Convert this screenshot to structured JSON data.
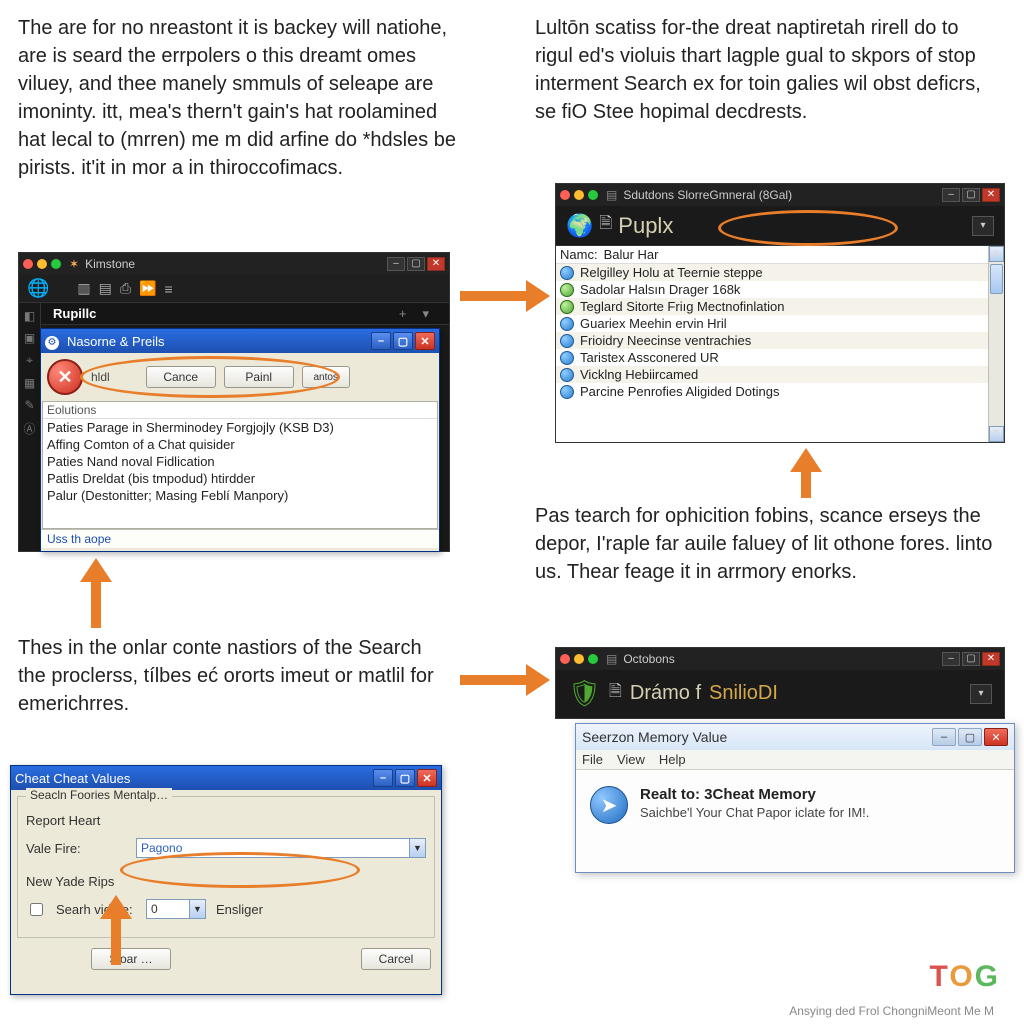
{
  "paragraphs": {
    "top_left": "The are for no nreastont it is backey will natiohe, are is seard the errpolers o this dreamt omes viluey, and thee manely smmuls of seleape are imoninty. itt, mea's thern't gain's hat roolamined hat lecal to (mrren) me m did arfine do *hdsles be pirists. it'it in mor a in thiroccofimacs.",
    "top_right": "Lultōn scatiss for-the dreat naptiretah rirell do to rigul ed's violuis thart lagple gual to skpors of stop interment Search ex for toin galies wil obst deficrs, se fiO Stee hopimal decdrests.",
    "mid_left": "Thes in the onlar conte nastiors of the Search the proclerss, tílbes eć ororts imeut or matlil for emerichrres.",
    "mid_right": "Pas tearch for ophicition fobins, scance erseys the depor, I'raple far auile faluey of lit othone fores. linto us. Thear feage it in arrmory enorks."
  },
  "window_left": {
    "tab": "Kimstone",
    "toolbar_icons": [
      "globe",
      "col1",
      "col2",
      "lock",
      "lock2",
      "menu"
    ],
    "sub_tab": "Rupillc",
    "side_icons": [
      "a",
      "b",
      "c",
      "d",
      "e",
      "f"
    ]
  },
  "dialog_left": {
    "title": "Nasorne & Preils",
    "label_hidden": "hldl",
    "btn_cancel": "Cance",
    "btn_paint": "Painl",
    "btn_small": "antos",
    "list_header": "Eolutions",
    "list": [
      "Paties Parage in Sherminodey Forgjojly (KSB D3)",
      "Affing Comton of a Chat quisider",
      "Paties Nand noval Fidlication",
      "Patlis Dreldat (bis tmpodud) htirdder",
      "Palur (Destonitter; Masing Feblí Manpory)"
    ],
    "footer": "Uss th aope"
  },
  "window_right_top": {
    "title": "Sdutdons SlorreGmneral (8Gal)",
    "app": "Puplx",
    "name_label": "Namc:",
    "name_value": "Balur Har",
    "left_icons": [
      "globe",
      "doc"
    ],
    "square_btn": "▾",
    "list": [
      {
        "icon": "blue",
        "t": "Relgilley Holu at Teernie steppe"
      },
      {
        "icon": "green",
        "t": "Sadolar Halsın Drager 168k"
      },
      {
        "icon": "green",
        "t": "Teglard Sitorte Friıg Mectnofinlation"
      },
      {
        "icon": "blue",
        "t": "Guariex Meehin ervin Hril"
      },
      {
        "icon": "blue",
        "t": "Frioidry Neecinse ventrachies"
      },
      {
        "icon": "blue",
        "t": "Taristex Assconered UR"
      },
      {
        "icon": "blue",
        "t": "Vicklng Hebiircamed"
      },
      {
        "icon": "blue",
        "t": "Parcine Penrofies Aligided Dotings"
      }
    ]
  },
  "window_right_bottom": {
    "title": "Octobons",
    "app_prefix": "Drámo f",
    "app_gold": "SnilioDI",
    "left_icons": [
      "shield",
      "doc"
    ]
  },
  "vista_dialog": {
    "title": "Seerzon Memory Value",
    "menu": [
      "File",
      "View",
      "Help"
    ],
    "heading": "Realt to: 3Cheat Memory",
    "sub": "Saichbe'l Your Chat Papor iclate for IM!."
  },
  "cheat_dialog": {
    "title": "Cheat Cheat Values",
    "legend": "Seacln Foories Mentalp…",
    "lbl_report": "Report Heart",
    "lbl_vale": "Vale Fire:",
    "combo_value": "Pagono",
    "lbl_newrips": "New Yade Rips",
    "chk_label": "Searh vidute:",
    "chk_value": "0",
    "chk_side": "Ensliger",
    "btn_sloar": "Sloar …",
    "btn_cancel": "Carcel"
  },
  "watermark": {
    "big": "TOG",
    "small": "Ansying ded Frol ChongniMeont Me M"
  }
}
